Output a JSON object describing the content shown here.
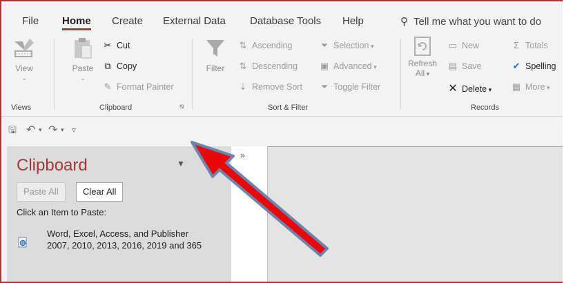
{
  "tabs": [
    {
      "label": "File"
    },
    {
      "label": "Home",
      "active": true
    },
    {
      "label": "Create"
    },
    {
      "label": "External Data"
    },
    {
      "label": "Database Tools"
    },
    {
      "label": "Help"
    }
  ],
  "tell_me": "Tell me what you want to do",
  "ribbon": {
    "views": {
      "view_label": "View",
      "group_label": "Views"
    },
    "clipboard": {
      "paste_label": "Paste",
      "cut_label": "Cut",
      "copy_label": "Copy",
      "format_painter_label": "Format Painter",
      "group_label": "Clipboard"
    },
    "sort_filter": {
      "filter_label": "Filter",
      "ascending_label": "Ascending",
      "descending_label": "Descending",
      "remove_sort_label": "Remove Sort",
      "selection_label": "Selection",
      "advanced_label": "Advanced",
      "toggle_filter_label": "Toggle Filter",
      "group_label": "Sort & Filter"
    },
    "records": {
      "refresh_label": "Refresh",
      "refresh_all_label": "All",
      "new_label": "New",
      "save_label": "Save",
      "delete_label": "Delete",
      "totals_label": "Totals",
      "spelling_label": "Spelling",
      "more_label": "More",
      "group_label": "Records"
    }
  },
  "clipboard_pane": {
    "title": "Clipboard",
    "paste_all_label": "Paste All",
    "clear_all_label": "Clear All",
    "hint": "Click an Item to Paste:",
    "items": [
      {
        "text": "Word, Excel, Access, and Publisher 2007, 2010, 2013, 2016, 2019 and 365"
      }
    ]
  },
  "nav_strip": {
    "expand_glyph": "»"
  },
  "colors": {
    "accent": "#a4373a",
    "arrow_fill": "#e8070a",
    "arrow_outline": "#6f84ad"
  }
}
